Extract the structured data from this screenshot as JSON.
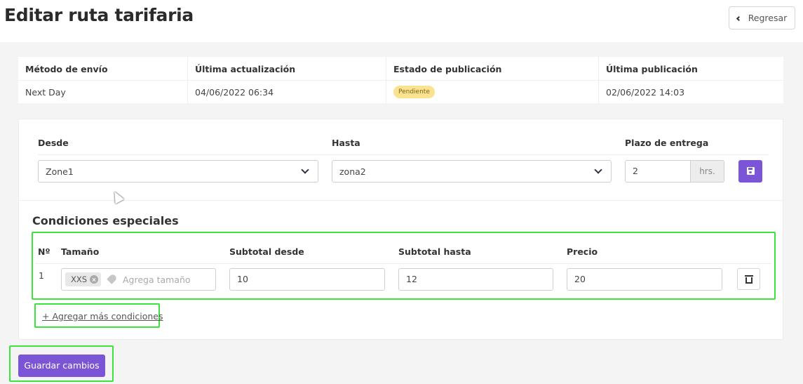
{
  "header": {
    "title": "Editar ruta tarifaria",
    "back_label": "Regresar"
  },
  "info": {
    "columns": [
      {
        "label": "Método de envío",
        "value": "Next Day"
      },
      {
        "label": "Última actualización",
        "value": "04/06/2022 06:34"
      },
      {
        "label": "Estado de publicación",
        "value": "Pendiente"
      },
      {
        "label": "Última publicación",
        "value": "02/06/2022 14:03"
      }
    ],
    "badge_color": "#fbe28e"
  },
  "route": {
    "desde_label": "Desde",
    "desde_value": "Zone1",
    "hasta_label": "Hasta",
    "hasta_value": "zona2",
    "plazo_label": "Plazo de entrega",
    "plazo_value": "2",
    "plazo_unit": "hrs."
  },
  "conditions": {
    "title": "Condiciones especiales",
    "headers": [
      "Nº",
      "Tamaño",
      "Subtotal desde",
      "Subtotal hasta",
      "Precio"
    ],
    "rows": [
      {
        "n": "1",
        "size_tag": "XXS",
        "size_placeholder": "Agrega tamaño",
        "subtotal_desde": "10",
        "subtotal_hasta": "12",
        "precio": "20"
      }
    ],
    "add_label": "+ Agregar más condiciones"
  },
  "footer": {
    "save_label": "Guardar cambios"
  },
  "colors": {
    "accent": "#7b55d6",
    "highlight": "#3be53b"
  }
}
